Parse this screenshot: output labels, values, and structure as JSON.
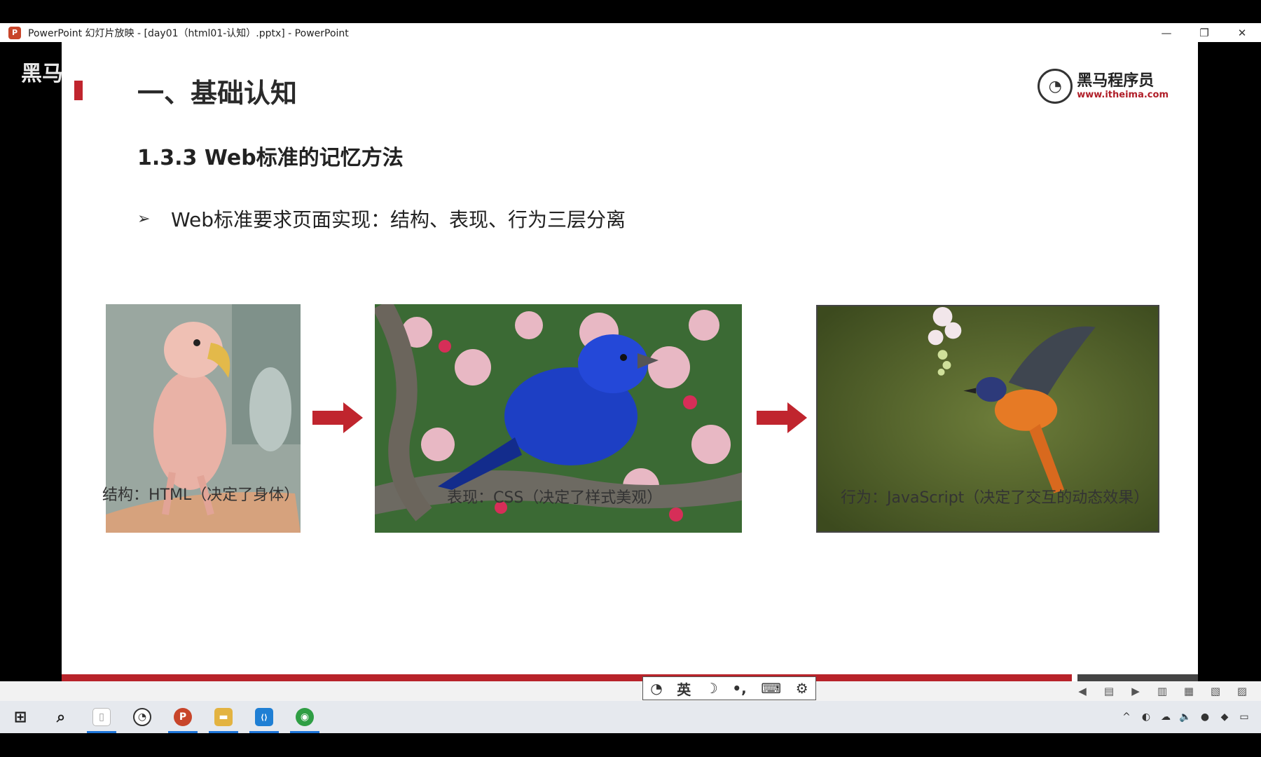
{
  "window": {
    "app_icon_letter": "P",
    "title": "PowerPoint 幻灯片放映 - [day01（html01-认知）.pptx] - PowerPoint",
    "controls": {
      "minimize": "—",
      "restore": "❐",
      "close": "✕"
    }
  },
  "watermark": "黑马",
  "slide": {
    "title": "一、基础认知",
    "logo": {
      "mark": "◔",
      "name": "黑马程序员",
      "url": "www.itheima.com"
    },
    "section_heading": "1.3.3 Web标准的记忆方法",
    "bullet": {
      "arrow": "➢",
      "text": "Web标准要求页面实现：结构、表现、行为三层分离"
    },
    "panels": [
      {
        "caption": "结构：HTML（决定了身体）",
        "image": "featherless-parrot"
      },
      {
        "caption": "表现：CSS（决定了样式美观）",
        "image": "blue-bird-on-branch"
      },
      {
        "caption": "行为：JavaScript（决定了交互的动态效果）",
        "image": "flying-bird"
      }
    ],
    "accent_color": "#b8232a"
  },
  "ime_bar": {
    "items": [
      "◔",
      "英",
      "☽",
      "•,",
      "⌨",
      "⚙"
    ]
  },
  "slideshow_controls": [
    "◀",
    "▤",
    "▶",
    "▥",
    "▦",
    "▧",
    "▨"
  ],
  "taskbar": {
    "apps": [
      {
        "name": "start",
        "glyph": "⊞",
        "color": "#1f1f1f"
      },
      {
        "name": "search",
        "glyph": "⌕",
        "color": "#1f1f1f"
      },
      {
        "name": "file",
        "glyph": "▯",
        "color": "#ffffff"
      },
      {
        "name": "recorder",
        "glyph": "◔",
        "color": "#333333"
      },
      {
        "name": "powerpoint",
        "glyph": "P",
        "color": "#c8452a"
      },
      {
        "name": "explorer",
        "glyph": "▬",
        "color": "#e3b341"
      },
      {
        "name": "vscode",
        "glyph": "⟨⟩",
        "color": "#1f7fd4"
      },
      {
        "name": "chrome",
        "glyph": "◉",
        "color": "#2f9e44"
      }
    ],
    "tray": [
      "^",
      "◐",
      "☁",
      "🔈",
      "●",
      "◆",
      "▭"
    ]
  }
}
